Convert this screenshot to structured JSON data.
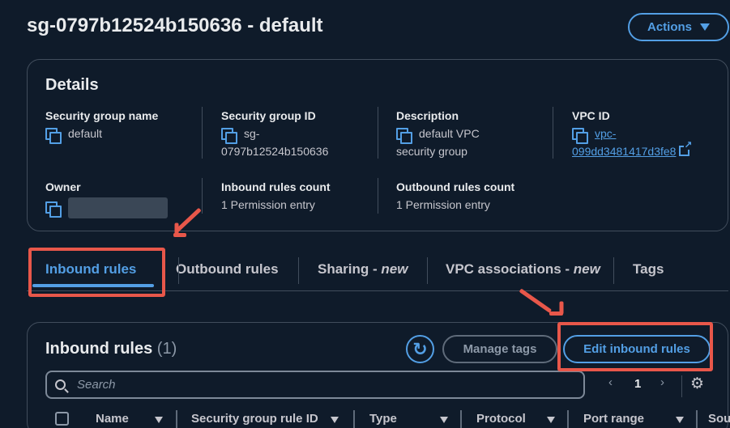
{
  "page": {
    "title": "sg-0797b12524b150636 - default"
  },
  "header": {
    "actions_label": "Actions"
  },
  "details": {
    "title": "Details",
    "security_group_name": {
      "label": "Security group name",
      "value": "default"
    },
    "security_group_id": {
      "label": "Security group ID",
      "value_line1": "sg-",
      "value_line2": "0797b12524b150636"
    },
    "description": {
      "label": "Description",
      "value_line1": "default VPC",
      "value_line2": "security group"
    },
    "vpc_id": {
      "label": "VPC ID",
      "value_line1": "vpc-",
      "value_line2": "099dd3481417d3fe8"
    },
    "owner": {
      "label": "Owner"
    },
    "inbound_count": {
      "label": "Inbound rules count",
      "value": "1 Permission entry"
    },
    "outbound_count": {
      "label": "Outbound rules count",
      "value": "1 Permission entry"
    }
  },
  "tabs": [
    {
      "label": "Inbound rules",
      "suffix": ""
    },
    {
      "label": "Outbound rules",
      "suffix": ""
    },
    {
      "label": "Sharing - ",
      "suffix": "new"
    },
    {
      "label": "VPC associations - ",
      "suffix": "new"
    },
    {
      "label": "Tags",
      "suffix": ""
    }
  ],
  "rules": {
    "title": "Inbound rules",
    "count": "(1)",
    "refresh_icon": "↻",
    "manage_tags_label": "Manage tags",
    "edit_label": "Edit inbound rules",
    "search_placeholder": "Search",
    "page_number": "1",
    "prev": "‹",
    "next": "›",
    "gear": "⚙",
    "columns": [
      "Name",
      "Security group rule ID",
      "Type",
      "Protocol",
      "Port range",
      "Sou"
    ]
  },
  "colors": {
    "accent": "#539fe5",
    "highlight": "#e8574a",
    "background": "#0f1b2a"
  }
}
